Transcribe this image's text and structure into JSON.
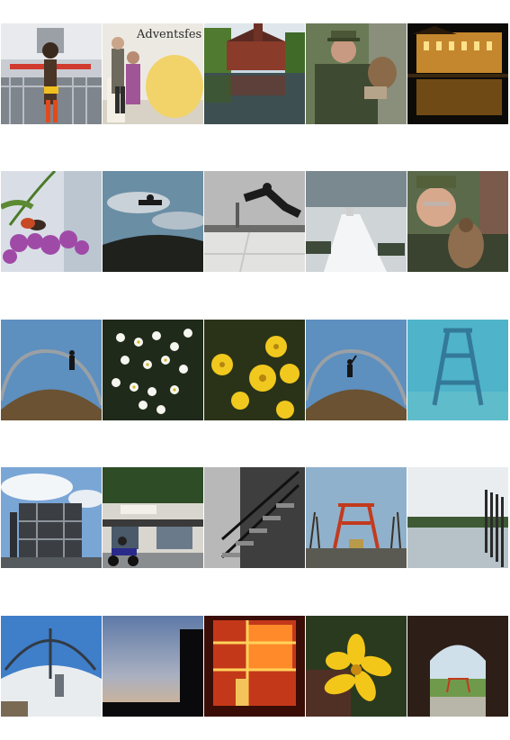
{
  "gallery": {
    "rows": [
      {
        "items": [
          {
            "name": "scarecrow-bridge",
            "label": ""
          },
          {
            "name": "advent-market",
            "label": "Adventsfes"
          },
          {
            "name": "castle-pond",
            "label": ""
          },
          {
            "name": "falconer-portrait",
            "label": ""
          },
          {
            "name": "castle-night",
            "label": ""
          }
        ]
      },
      {
        "items": [
          {
            "name": "butterfly-flowers",
            "label": ""
          },
          {
            "name": "jumper-slag-heap",
            "label": ""
          },
          {
            "name": "jumper-powerplant",
            "label": ""
          },
          {
            "name": "snow-stairway",
            "label": ""
          },
          {
            "name": "falconer-closeup",
            "label": ""
          }
        ]
      },
      {
        "items": [
          {
            "name": "arch-hill-jumper",
            "label": ""
          },
          {
            "name": "white-daisies",
            "label": ""
          },
          {
            "name": "yellow-daisies",
            "label": ""
          },
          {
            "name": "arch-hill-dancer",
            "label": ""
          },
          {
            "name": "headframe-blue",
            "label": ""
          }
        ]
      },
      {
        "items": [
          {
            "name": "industrial-plant",
            "label": ""
          },
          {
            "name": "snack-bar-scooter",
            "label": ""
          },
          {
            "name": "steel-staircase",
            "label": ""
          },
          {
            "name": "zollverein-headframe",
            "label": ""
          },
          {
            "name": "lake-sculpture",
            "label": ""
          }
        ]
      },
      {
        "items": [
          {
            "name": "snowy-arch",
            "label": ""
          },
          {
            "name": "dusk-silhouette",
            "label": ""
          },
          {
            "name": "orange-stairwell",
            "label": ""
          },
          {
            "name": "yellow-flower",
            "label": ""
          },
          {
            "name": "brick-archway",
            "label": ""
          }
        ]
      }
    ]
  }
}
